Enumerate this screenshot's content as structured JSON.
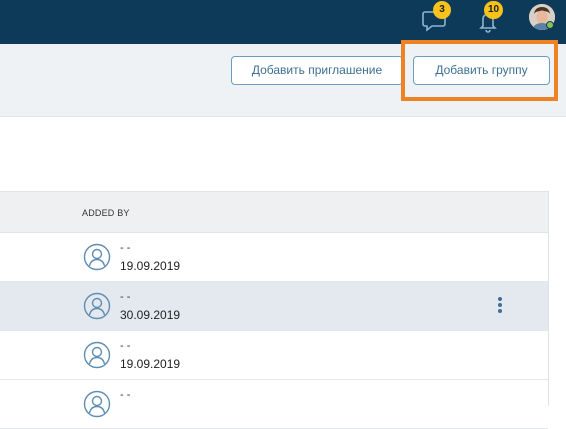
{
  "header": {
    "messages": {
      "icon": "chat-bubble-icon",
      "count": "3"
    },
    "notifications": {
      "icon": "bell-icon",
      "count": "10"
    },
    "avatar_icon": "user-avatar"
  },
  "actions": {
    "invite_label": "Добавить приглашение",
    "add_group_label": "Добавить группу"
  },
  "table": {
    "columns": {
      "added_by": "ADDED BY"
    },
    "rows": [
      {
        "name": "- -",
        "date": "19.09.2019",
        "selected": false
      },
      {
        "name": "- -",
        "date": "30.09.2019",
        "selected": true
      },
      {
        "name": "- -",
        "date": "19.09.2019",
        "selected": false
      },
      {
        "name": "- -",
        "date": "",
        "selected": false
      }
    ]
  },
  "colors": {
    "topbar": "#0e3a5a",
    "accent": "#3d6f93",
    "badge": "#f7c21a",
    "highlight": "#f08226"
  }
}
